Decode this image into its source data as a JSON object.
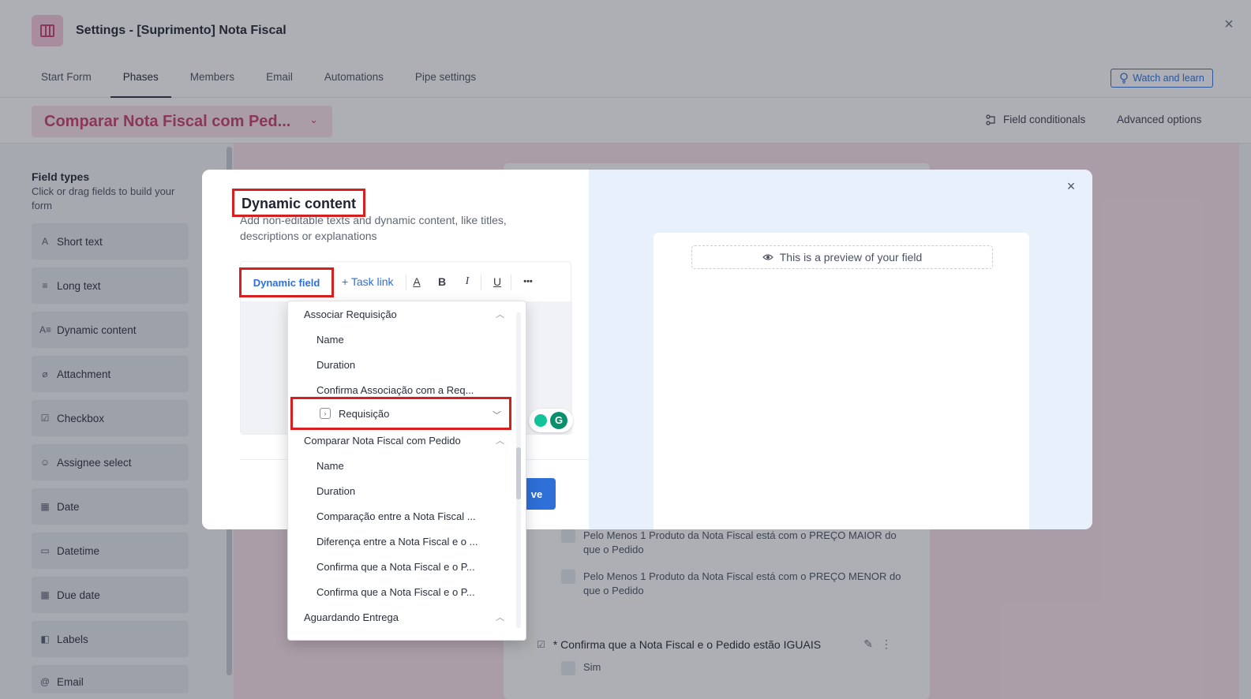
{
  "app": {
    "title": "Settings - [Suprimento] Nota Fiscal",
    "close_icon": "×"
  },
  "tabs": [
    {
      "label": "Start Form",
      "active": false
    },
    {
      "label": "Phases",
      "active": true
    },
    {
      "label": "Members",
      "active": false
    },
    {
      "label": "Email",
      "active": false
    },
    {
      "label": "Automations",
      "active": false
    },
    {
      "label": "Pipe settings",
      "active": false
    }
  ],
  "header": {
    "watch_label": "Watch and learn",
    "phase_select": "Comparar Nota Fiscal com Ped...",
    "field_conditionals": "Field conditionals",
    "advanced_options": "Advanced options"
  },
  "sidebar": {
    "title": "Field types",
    "description": "Click or drag fields to build your form",
    "items": [
      {
        "label": "Short text",
        "icon": "A"
      },
      {
        "label": "Long text",
        "icon": "≡"
      },
      {
        "label": "Dynamic content",
        "icon": "A≡"
      },
      {
        "label": "Attachment",
        "icon": "⌀"
      },
      {
        "label": "Checkbox",
        "icon": "☑"
      },
      {
        "label": "Assignee select",
        "icon": "☺"
      },
      {
        "label": "Date",
        "icon": "▦"
      },
      {
        "label": "Datetime",
        "icon": "▭"
      },
      {
        "label": "Due date",
        "icon": "▦"
      },
      {
        "label": "Labels",
        "icon": "◧"
      },
      {
        "label": "Email",
        "icon": "@"
      }
    ]
  },
  "form": {
    "options": [
      "Pelo Menos 1 Produto da Nota Fiscal está com o PREÇO MAIOR do que o Pedido",
      "Pelo Menos 1 Produto da Nota Fiscal está com o PREÇO MENOR do que o Pedido"
    ],
    "confirm_label": "Confirma que a Nota Fiscal e o Pedido estão IGUAIS",
    "required_mark": "*",
    "sim_label": "Sim"
  },
  "modal": {
    "title": "Dynamic content",
    "description": "Add non-editable texts and dynamic content, like titles, descriptions or explanations",
    "toolbar": {
      "dynamic_field": "Dynamic field",
      "task_link": "+ Task link",
      "font_color": "A",
      "bold": "B",
      "italic": "I",
      "underline": "U",
      "more": "•••"
    },
    "save_label": "ve",
    "preview_note": "This is a preview of your field",
    "close_icon": "×"
  },
  "dropdown": {
    "groups": [
      {
        "label": "Associar Requisição",
        "items": [
          "Name",
          "Duration",
          "Confirma Associação com a Req..."
        ],
        "highlight": "Requisição"
      },
      {
        "label": "Comparar Nota Fiscal com Pedido",
        "items": [
          "Name",
          "Duration",
          "Comparação entre a Nota Fiscal ...",
          "Diferença entre a Nota Fiscal e o ...",
          "Confirma que a Nota Fiscal e o P...",
          "Confirma que a Nota Fiscal e o P..."
        ]
      },
      {
        "label": "Aguardando Entrega",
        "items": []
      }
    ]
  },
  "colors": {
    "accent": "#2e6fd8",
    "phase": "#c73e6e",
    "highlight_box": "#d61f1f"
  }
}
